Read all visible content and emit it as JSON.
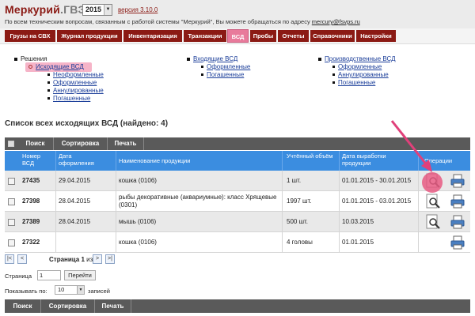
{
  "header": {
    "app_name": "Меркурий",
    "app_suffix": ".ГВЭ",
    "year": "2015",
    "version": "версия 3.10.0",
    "support_text": "По всем техническим вопросам, связанным с работой системы \"Меркурий\", Вы можете обращаться по адресу",
    "support_email": "mercury@fsvps.ru"
  },
  "menu": [
    {
      "label": "Грузы на СВХ",
      "active": false
    },
    {
      "label": "Журнал продукции",
      "active": false
    },
    {
      "label": "Инвентаризация",
      "active": false
    },
    {
      "label": "Транзакции",
      "active": false
    },
    {
      "label": "ВСД",
      "active": true
    },
    {
      "label": "Пробы",
      "active": false
    },
    {
      "label": "Отчеты",
      "active": false
    },
    {
      "label": "Справочники",
      "active": false
    },
    {
      "label": "Настройки",
      "active": false
    }
  ],
  "nav": {
    "col1": {
      "root": "Решения",
      "current": "Исходящие ВСД",
      "children": [
        "Неоформленные",
        "Оформленные",
        "Аннулированные",
        "Погашенные"
      ]
    },
    "col2": {
      "root": "Входящие ВСД",
      "children": [
        "Оформленные",
        "Погашенные"
      ]
    },
    "col3": {
      "root": "Производственные ВСД",
      "children": [
        "Оформленные",
        "Аннулированные",
        "Погашенные"
      ]
    }
  },
  "list_title": "Список всех исходящих ВСД (найдено: 4)",
  "toolbar": {
    "search": "Поиск",
    "sort": "Сортировка",
    "print": "Печать"
  },
  "table": {
    "headers": {
      "number": "Номер ВСД",
      "date": "Дата оформления",
      "product": "Наименование продукции",
      "volume": "Учтённый объём",
      "production_date": "Дата выработки продукции",
      "operations": "Операции"
    },
    "rows": [
      {
        "number": "27435",
        "date": "29.04.2015",
        "product": "кошка (0106)",
        "volume": "1 шт.",
        "production_date": "01.01.2015 - 30.01.2015"
      },
      {
        "number": "27398",
        "date": "28.04.2015",
        "product": "рыбы декоративные (аквариумные): класс Хрящевые (0301)",
        "volume": "1997 шт.",
        "production_date": "01.01.2015 - 03.01.2015"
      },
      {
        "number": "27389",
        "date": "28.04.2015",
        "product": "мышь (0106)",
        "volume": "500 шт.",
        "production_date": "10.03.2015"
      },
      {
        "number": "27322",
        "date": "",
        "product": "кошка (0106)",
        "volume": "4 головы",
        "production_date": "01.01.2015"
      }
    ]
  },
  "pager": {
    "first": "|<",
    "prev": "<",
    "label_page": "Страница",
    "current_page": "1",
    "label_of": "из",
    "total_pages": "1",
    "next": ">",
    "last": ">|",
    "goto_label": "Страница",
    "goto_value": "1",
    "goto_button": "Перейти",
    "perpage_label": "Показывать по:",
    "perpage_value": "10",
    "perpage_suffix": "записей"
  },
  "colors": {
    "brand": "#8b1a14",
    "active_tab": "#e87a9b",
    "table_header": "#3b8de0",
    "toolbar": "#5a5a5a",
    "link": "#1a3d99",
    "annotation": "#e0407a"
  },
  "icons": {
    "view": "magnifier-document-icon",
    "print": "printer-icon"
  }
}
